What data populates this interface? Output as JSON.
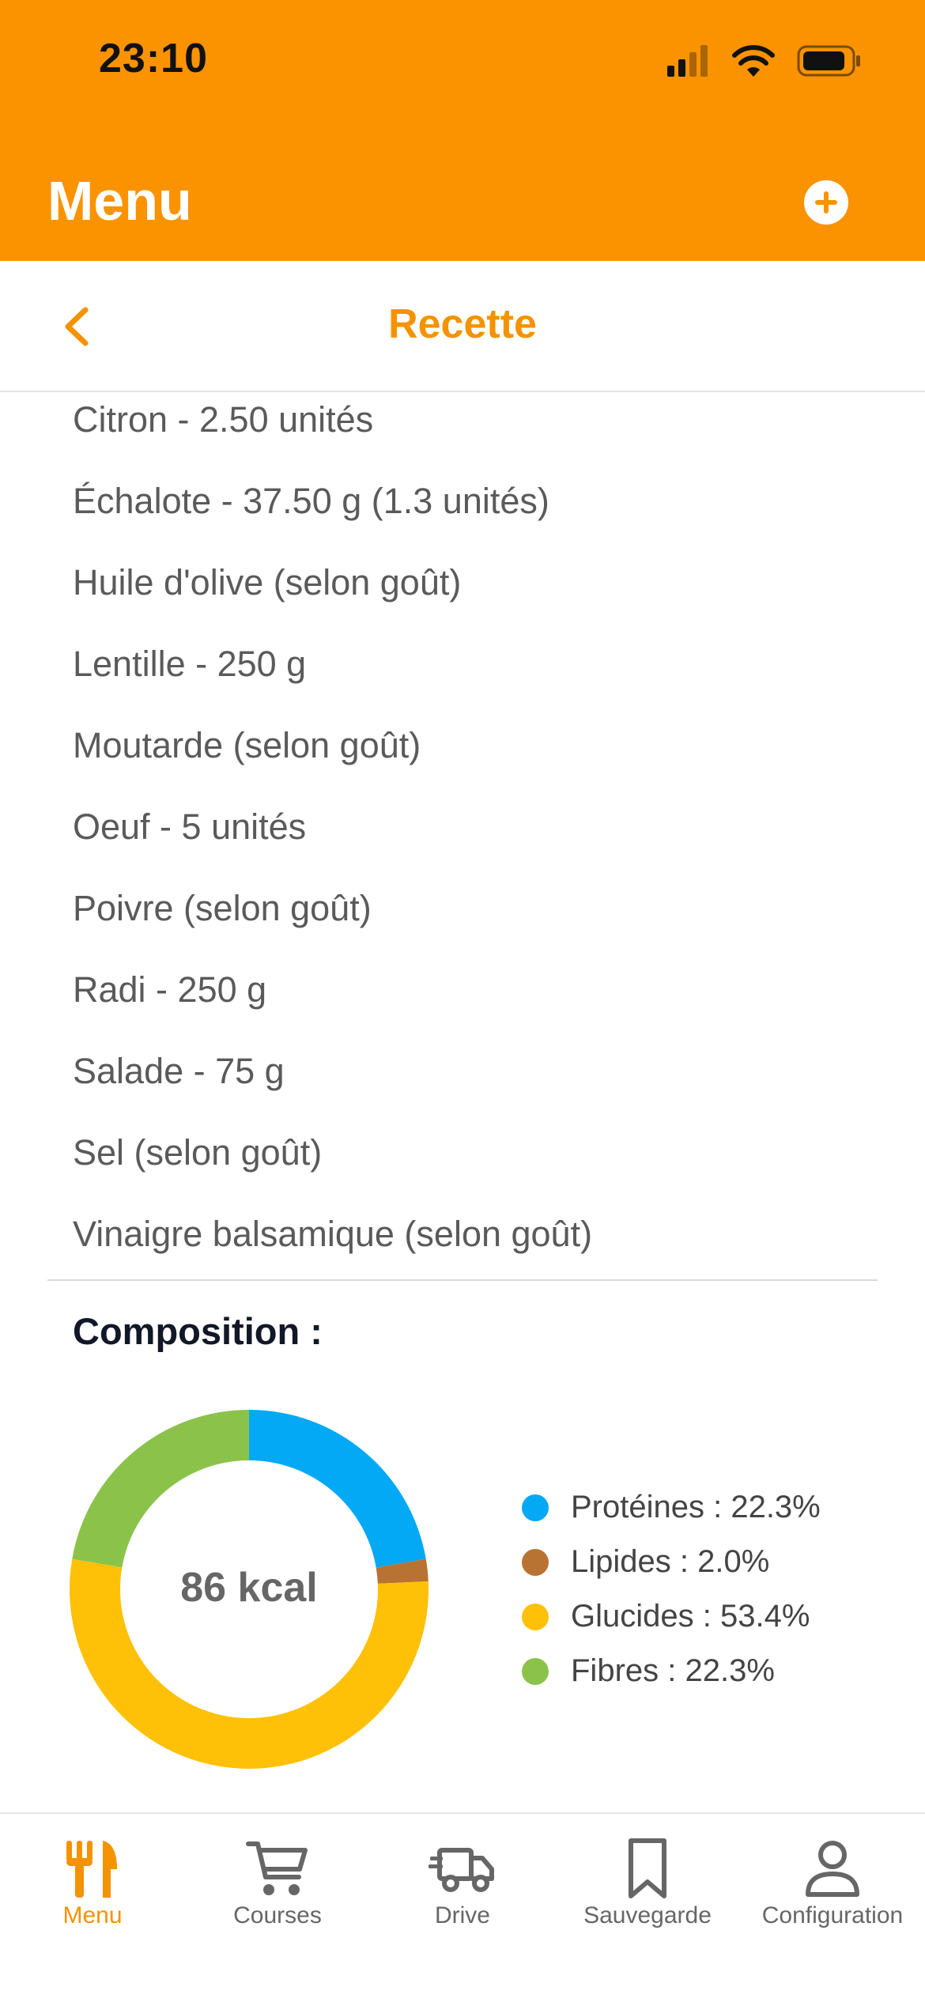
{
  "status_bar": {
    "time": "23:10"
  },
  "header": {
    "title": "Menu",
    "add_icon": "plus-circle-icon"
  },
  "sub_header": {
    "title": "Recette",
    "back_icon": "chevron-left-icon"
  },
  "ingredients": [
    "Citron - 2.50 unités",
    "Échalote - 37.50 g (1.3 unités)",
    "Huile d'olive (selon goût)",
    "Lentille - 250 g",
    "Moutarde (selon goût)",
    "Oeuf - 5 unités",
    "Poivre (selon goût)",
    "Radi - 250 g",
    "Salade - 75 g",
    "Sel (selon goût)",
    "Vinaigre balsamique (selon goût)"
  ],
  "composition": {
    "title": "Composition :",
    "center_label": "86 kcal",
    "legend": [
      "Protéines : 22.3%",
      "Lipides : 2.0%",
      "Glucides : 53.4%",
      "Fibres : 22.3%"
    ]
  },
  "chart_data": {
    "type": "pie",
    "categories": [
      "Protéines",
      "Lipides",
      "Glucides",
      "Fibres"
    ],
    "values": [
      22.3,
      2.0,
      53.4,
      22.3
    ],
    "colors": [
      "#03A9F4",
      "#B87333",
      "#FFC107",
      "#8BC34A"
    ]
  },
  "tabs": [
    {
      "label": "Menu",
      "icon": "fork-knife-icon",
      "active": true
    },
    {
      "label": "Courses",
      "icon": "shopping-cart-icon",
      "active": false
    },
    {
      "label": "Drive",
      "icon": "delivery-truck-icon",
      "active": false
    },
    {
      "label": "Sauvegarde",
      "icon": "bookmark-icon",
      "active": false
    },
    {
      "label": "Configuration",
      "icon": "user-icon",
      "active": false
    }
  ],
  "colors": {
    "accent": "#FB9300",
    "active_tab": "#F59200",
    "inactive_tab": "#666666"
  }
}
